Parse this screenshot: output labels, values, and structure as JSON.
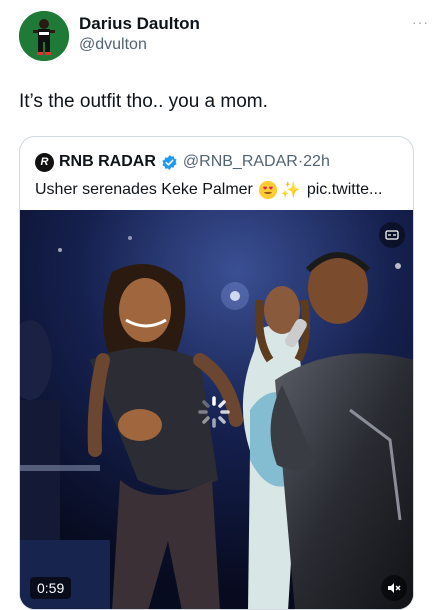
{
  "author": {
    "name": "Darius Daulton",
    "handle": "@dvulton",
    "avatar_icon": "basketball-player-avatar",
    "avatar_color": "#1f7a37"
  },
  "more_icon": "more-options-icon",
  "text": "It’s the outfit tho.. you a mom.",
  "quoted": {
    "logo_letter": "R",
    "name": "RNB RADAR",
    "verified_color": "#1d9bf0",
    "handle": "@RNB_RADAR",
    "separator": "·",
    "time": "22h",
    "text_before": "Usher serenades Keke Palmer",
    "text_after": "pic.twitte...",
    "media": {
      "type": "video",
      "duration": "0:59",
      "mute_icon": "speaker-muted-icon",
      "alt_icon": "video-settings-icon",
      "loading_icon": "loading-spinner-icon"
    }
  },
  "colors": {
    "text": "#0f1419",
    "secondary": "#536471",
    "border": "#cfd9de"
  }
}
